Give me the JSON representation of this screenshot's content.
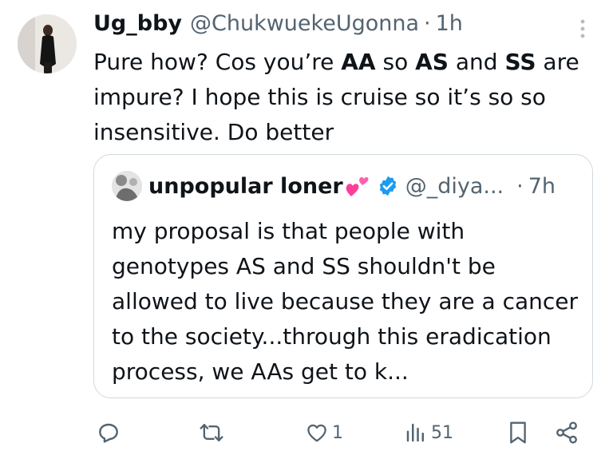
{
  "tweet": {
    "display_name": "Ug_bby",
    "handle": "@ChukwuekeUgonna",
    "separator": "·",
    "time": "1h",
    "text_parts": [
      "Pure how? Cos you’re ",
      "AA",
      " so ",
      "AS",
      " and ",
      "SS",
      " are impure? I hope this is cruise so it’s so so insensitive. Do better"
    ]
  },
  "quoted_tweet": {
    "display_name": "unpopular loner",
    "handle": "@_diya...",
    "separator": "·",
    "time": "7h",
    "text": "my proposal is that people with genotypes AS and SS shouldn't be allowed to live because they are a cancer to the society...through this eradication process, we AAs get to k..."
  },
  "actions": {
    "reply_icon": "reply-icon",
    "retweet_icon": "retweet-icon",
    "like_icon": "heart-icon",
    "like_count": "1",
    "views_icon": "views-icon",
    "views_count": "51",
    "bookmark_icon": "bookmark-icon",
    "share_icon": "share-icon"
  },
  "colors": {
    "text_primary": "#0f1419",
    "text_secondary": "#536471",
    "border": "#cfd9de",
    "verified": "#1d9bf0",
    "heart_emoji": "#ff3e9a"
  }
}
